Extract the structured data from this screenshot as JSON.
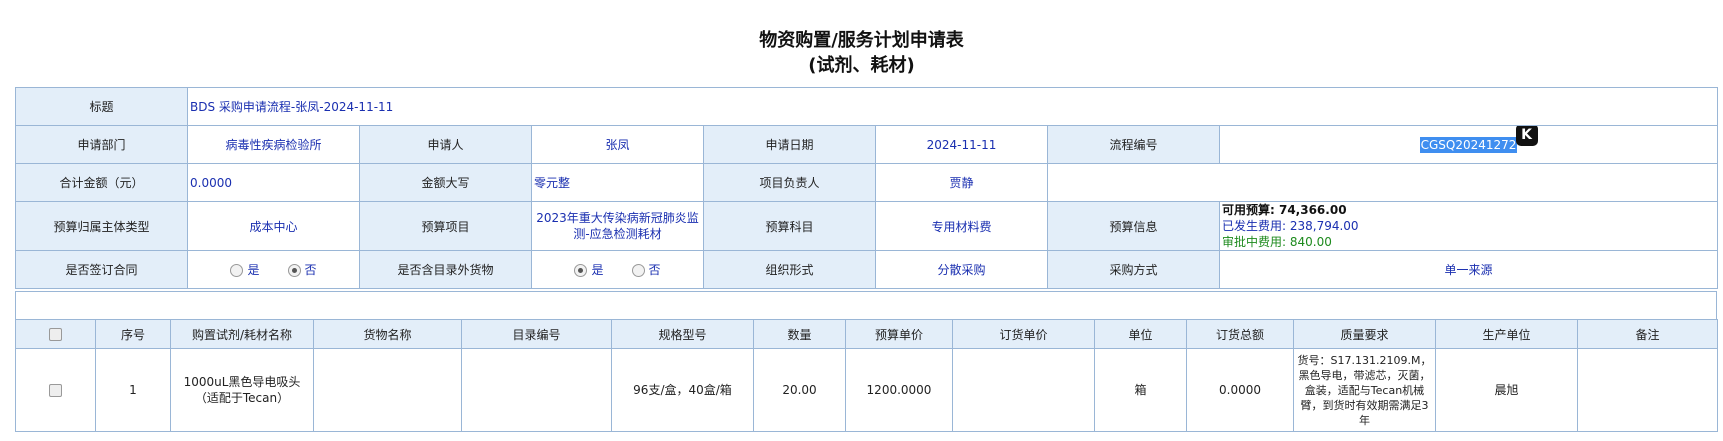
{
  "page": {
    "title_line1": "物资购置/服务计划申请表",
    "title_line2": "(试剂、耗材)"
  },
  "form": {
    "title_label": "标题",
    "title_value": "BDS 采购申请流程-张凤-2024-11-11",
    "dept_label": "申请部门",
    "dept_value": "病毒性疾病检验所",
    "applicant_label": "申请人",
    "applicant_value": "张凤",
    "date_label": "申请日期",
    "date_value": "2024-11-11",
    "flow_label": "流程编号",
    "flow_value": "CGSQ20241272",
    "flow_icon": "K",
    "amount_label": "合计金额（元）",
    "amount_value": "0.0000",
    "amount_upper_label": "金额大写",
    "amount_upper_value": "零元整",
    "manager_label": "项目负责人",
    "manager_value": "贾静",
    "budget_type_label": "预算归属主体类型",
    "budget_type_value": "成本中心",
    "budget_project_label": "预算项目",
    "budget_project_value": "2023年重大传染病新冠肺炎监测-应急检测耗材",
    "budget_subject_label": "预算科目",
    "budget_subject_value": "专用材料费",
    "budget_info_label": "预算信息",
    "budget_available": "可用预算:  74,366.00",
    "budget_spent": "已发生费用:  238,794.00",
    "budget_pending": "审批中费用:  840.00",
    "contract_label": "是否签订合同",
    "contract_yes": "是",
    "contract_no": "否",
    "contract_selected": "否",
    "outside_label": "是否含目录外货物",
    "outside_yes": "是",
    "outside_no": "否",
    "outside_selected": "是",
    "org_label": "组织形式",
    "org_value": "分散采购",
    "purchase_label": "采购方式",
    "purchase_value": "单一来源"
  },
  "items": {
    "headers": [
      "序号",
      "购置试剂/耗材名称",
      "货物名称",
      "目录编号",
      "规格型号",
      "数量",
      "预算单价",
      "订货单价",
      "单位",
      "订货总额",
      "质量要求",
      "生产单位",
      "备注"
    ],
    "rows": [
      {
        "index": "1",
        "name": "1000uL黑色导电吸头（适配于Tecan）",
        "goods": "",
        "catalog": "",
        "spec": "96支/盒，40盒/箱",
        "qty": "20.00",
        "budget_price": "1200.0000",
        "order_price": "",
        "unit": "箱",
        "order_total": "0.0000",
        "quality": "货号：S17.131.2109.M，黑色导电，带滤芯，灭菌，盒装，适配与Tecan机械臂，到货时有效期需满足3年",
        "maker": "晨旭",
        "remark": ""
      }
    ]
  },
  "icons": {
    "checkbox": "checkbox-icon",
    "radio": "radio-icon",
    "app": "k-app-icon"
  }
}
